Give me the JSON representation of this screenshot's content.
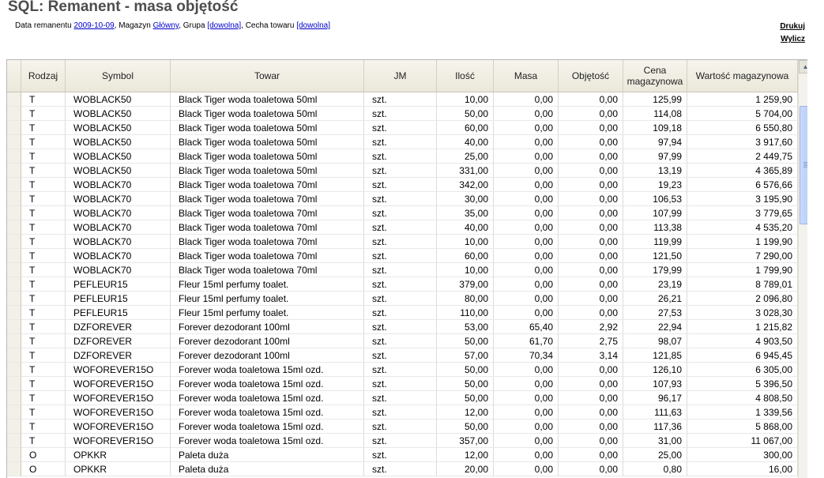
{
  "title": "SQL: Remanent - masa objętość",
  "info": {
    "date_label": "Data remanentu ",
    "date_value": "2009-10-09",
    "sep1": ", Magazyn ",
    "warehouse_value": "Główny",
    "sep2": ", Grupa ",
    "group_value": "[dowolna]",
    "sep3": ", Cecha towaru ",
    "feature_value": "[dowolna]"
  },
  "actions": {
    "print": "Drukuj",
    "calculate": "Wylicz"
  },
  "table": {
    "headers": [
      "Rodzaj",
      "Symbol",
      "Towar",
      "JM",
      "Ilość",
      "Masa",
      "Objętość",
      "Cena magazynowa",
      "Wartość magazynowa"
    ],
    "rows": [
      [
        "T",
        "WOBLACK50",
        "Black Tiger woda toaletowa 50ml",
        "szt.",
        "10,00",
        "0,00",
        "0,00",
        "125,99",
        "1 259,90"
      ],
      [
        "T",
        "WOBLACK50",
        "Black Tiger woda toaletowa 50ml",
        "szt.",
        "50,00",
        "0,00",
        "0,00",
        "114,08",
        "5 704,00"
      ],
      [
        "T",
        "WOBLACK50",
        "Black Tiger woda toaletowa 50ml",
        "szt.",
        "60,00",
        "0,00",
        "0,00",
        "109,18",
        "6 550,80"
      ],
      [
        "T",
        "WOBLACK50",
        "Black Tiger woda toaletowa 50ml",
        "szt.",
        "40,00",
        "0,00",
        "0,00",
        "97,94",
        "3 917,60"
      ],
      [
        "T",
        "WOBLACK50",
        "Black Tiger woda toaletowa 50ml",
        "szt.",
        "25,00",
        "0,00",
        "0,00",
        "97,99",
        "2 449,75"
      ],
      [
        "T",
        "WOBLACK50",
        "Black Tiger woda toaletowa 50ml",
        "szt.",
        "331,00",
        "0,00",
        "0,00",
        "13,19",
        "4 365,89"
      ],
      [
        "T",
        "WOBLACK70",
        "Black Tiger woda toaletowa 70ml",
        "szt.",
        "342,00",
        "0,00",
        "0,00",
        "19,23",
        "6 576,66"
      ],
      [
        "T",
        "WOBLACK70",
        "Black Tiger woda toaletowa 70ml",
        "szt.",
        "30,00",
        "0,00",
        "0,00",
        "106,53",
        "3 195,90"
      ],
      [
        "T",
        "WOBLACK70",
        "Black Tiger woda toaletowa 70ml",
        "szt.",
        "35,00",
        "0,00",
        "0,00",
        "107,99",
        "3 779,65"
      ],
      [
        "T",
        "WOBLACK70",
        "Black Tiger woda toaletowa 70ml",
        "szt.",
        "40,00",
        "0,00",
        "0,00",
        "113,38",
        "4 535,20"
      ],
      [
        "T",
        "WOBLACK70",
        "Black Tiger woda toaletowa 70ml",
        "szt.",
        "10,00",
        "0,00",
        "0,00",
        "119,99",
        "1 199,90"
      ],
      [
        "T",
        "WOBLACK70",
        "Black Tiger woda toaletowa 70ml",
        "szt.",
        "60,00",
        "0,00",
        "0,00",
        "121,50",
        "7 290,00"
      ],
      [
        "T",
        "WOBLACK70",
        "Black Tiger woda toaletowa 70ml",
        "szt.",
        "10,00",
        "0,00",
        "0,00",
        "179,99",
        "1 799,90"
      ],
      [
        "T",
        "PEFLEUR15",
        "Fleur 15ml perfumy toalet.",
        "szt.",
        "379,00",
        "0,00",
        "0,00",
        "23,19",
        "8 789,01"
      ],
      [
        "T",
        "PEFLEUR15",
        "Fleur 15ml perfumy toalet.",
        "szt.",
        "80,00",
        "0,00",
        "0,00",
        "26,21",
        "2 096,80"
      ],
      [
        "T",
        "PEFLEUR15",
        "Fleur 15ml perfumy toalet.",
        "szt.",
        "110,00",
        "0,00",
        "0,00",
        "27,53",
        "3 028,30"
      ],
      [
        "T",
        "DZFOREVER",
        "Forever dezodorant 100ml",
        "szt.",
        "53,00",
        "65,40",
        "2,92",
        "22,94",
        "1 215,82"
      ],
      [
        "T",
        "DZFOREVER",
        "Forever dezodorant 100ml",
        "szt.",
        "50,00",
        "61,70",
        "2,75",
        "98,07",
        "4 903,50"
      ],
      [
        "T",
        "DZFOREVER",
        "Forever dezodorant 100ml",
        "szt.",
        "57,00",
        "70,34",
        "3,14",
        "121,85",
        "6 945,45"
      ],
      [
        "T",
        "WOFOREVER15O",
        "Forever woda toaletowa 15ml ozd.",
        "szt.",
        "50,00",
        "0,00",
        "0,00",
        "126,10",
        "6 305,00"
      ],
      [
        "T",
        "WOFOREVER15O",
        "Forever woda toaletowa 15ml ozd.",
        "szt.",
        "50,00",
        "0,00",
        "0,00",
        "107,93",
        "5 396,50"
      ],
      [
        "T",
        "WOFOREVER15O",
        "Forever woda toaletowa 15ml ozd.",
        "szt.",
        "50,00",
        "0,00",
        "0,00",
        "96,17",
        "4 808,50"
      ],
      [
        "T",
        "WOFOREVER15O",
        "Forever woda toaletowa 15ml ozd.",
        "szt.",
        "12,00",
        "0,00",
        "0,00",
        "111,63",
        "1 339,56"
      ],
      [
        "T",
        "WOFOREVER15O",
        "Forever woda toaletowa 15ml ozd.",
        "szt.",
        "50,00",
        "0,00",
        "0,00",
        "117,36",
        "5 868,00"
      ],
      [
        "T",
        "WOFOREVER15O",
        "Forever woda toaletowa 15ml ozd.",
        "szt.",
        "357,00",
        "0,00",
        "0,00",
        "31,00",
        "11 067,00"
      ],
      [
        "O",
        "OPKKR",
        "Paleta duża",
        "szt.",
        "12,00",
        "0,00",
        "0,00",
        "25,00",
        "300,00"
      ],
      [
        "O",
        "OPKKR",
        "Paleta duża",
        "szt.",
        "20,00",
        "0,00",
        "0,00",
        "0,80",
        "16,00"
      ]
    ]
  },
  "scrollbar": {
    "up_icon": "arrow-up-icon"
  }
}
